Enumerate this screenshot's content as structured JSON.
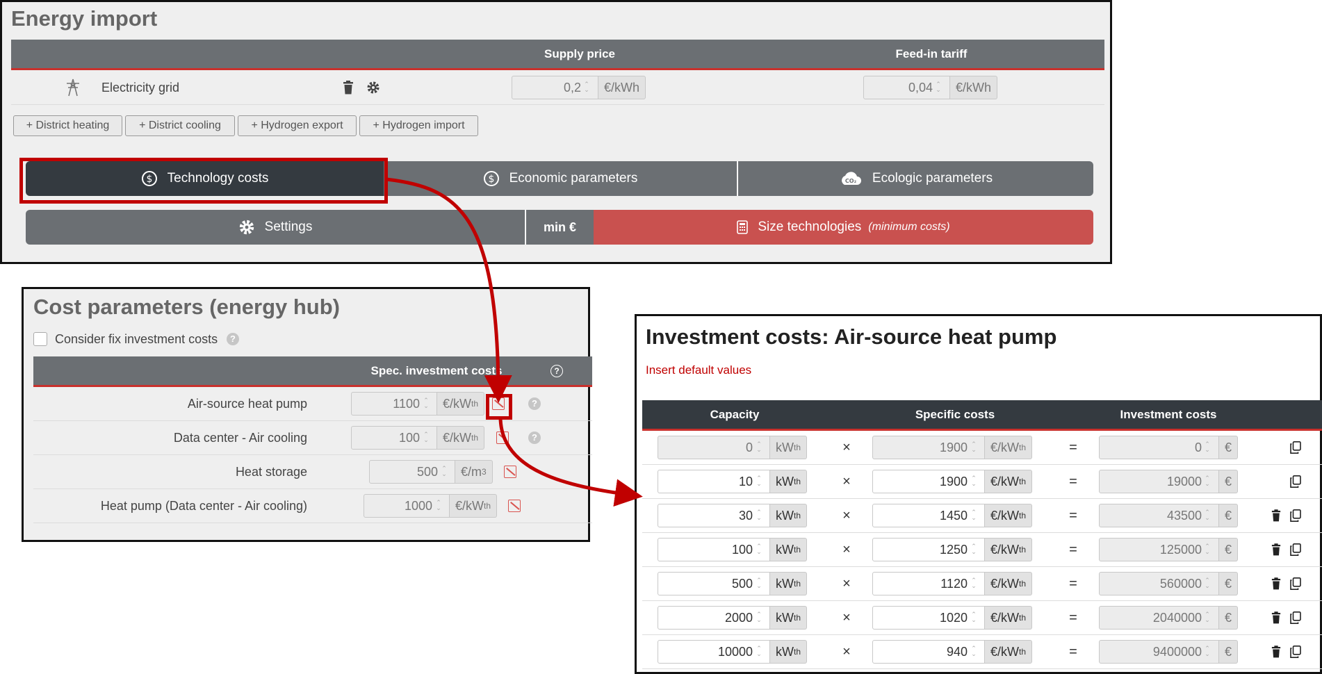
{
  "energy_import": {
    "title": "Energy import",
    "col_supply": "Supply price",
    "col_feedin": "Feed-in tariff",
    "grid": {
      "label": "Electricity grid",
      "supply": "0,2",
      "supply_unit": "€/kWh",
      "feedin": "0,04",
      "feedin_unit": "€/kWh"
    },
    "add_buttons": [
      "+ District heating",
      "+ District cooling",
      "+ Hydrogen export",
      "+ Hydrogen import"
    ],
    "tabs": {
      "tech": "Technology costs",
      "econ": "Economic parameters",
      "eco": "Ecologic parameters"
    },
    "settings": "Settings",
    "objective": "min €",
    "size_label": "Size technologies",
    "size_note": "(minimum costs)"
  },
  "cost_params": {
    "title": "Cost parameters (energy hub)",
    "checkbox_label": "Consider fix investment costs",
    "col_spec": "Spec. investment costs",
    "rows": [
      {
        "label": "Air-source heat pump",
        "value": "1100",
        "unit": "€/kW",
        "unit_sub": "th"
      },
      {
        "label": "Data center - Air cooling",
        "value": "100",
        "unit": "€/kW",
        "unit_sub": "th"
      },
      {
        "label": "Heat storage",
        "value": "500",
        "unit": "€/m",
        "unit_sup": "3"
      },
      {
        "label": "Heat pump (Data center - Air cooling)",
        "value": "1000",
        "unit": "€/kW",
        "unit_sub": "th"
      }
    ]
  },
  "investment": {
    "title": "Investment costs: Air-source heat pump",
    "default_link": "Insert default values",
    "col_capacity": "Capacity",
    "col_specific": "Specific costs",
    "col_invest": "Investment costs",
    "cap_unit": "kW",
    "cap_sub": "th",
    "spec_unit": "€/kW",
    "spec_sub": "th",
    "inv_unit": "€",
    "times": "×",
    "equals": "=",
    "rows": [
      {
        "capacity": "0",
        "specific": "1900",
        "investment": "0"
      },
      {
        "capacity": "10",
        "specific": "1900",
        "investment": "19000"
      },
      {
        "capacity": "30",
        "specific": "1450",
        "investment": "43500"
      },
      {
        "capacity": "100",
        "specific": "1250",
        "investment": "125000"
      },
      {
        "capacity": "500",
        "specific": "1120",
        "investment": "560000"
      },
      {
        "capacity": "2000",
        "specific": "1020",
        "investment": "2040000"
      },
      {
        "capacity": "10000",
        "specific": "940",
        "investment": "9400000"
      }
    ]
  },
  "colors": {
    "accent": "#c00000",
    "header": "#6b6f73",
    "active_tab": "#343a40",
    "size_button": "#c9514f"
  }
}
